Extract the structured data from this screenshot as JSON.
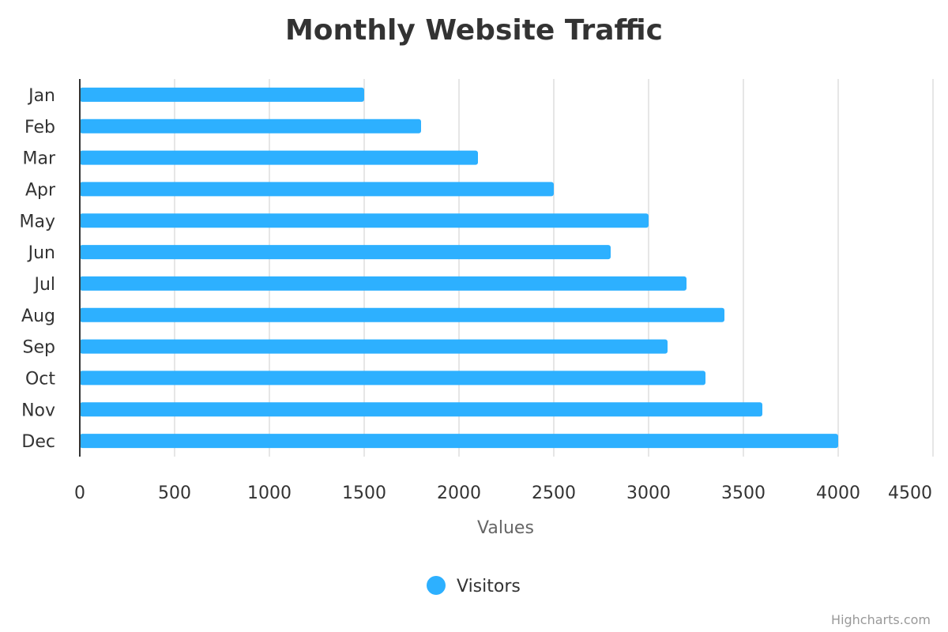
{
  "chart_data": {
    "type": "bar",
    "orientation": "horizontal",
    "title": "Monthly Website Traffic",
    "xlabel": "Values",
    "ylabel": "",
    "categories": [
      "Jan",
      "Feb",
      "Mar",
      "Apr",
      "May",
      "Jun",
      "Jul",
      "Aug",
      "Sep",
      "Oct",
      "Nov",
      "Dec"
    ],
    "series": [
      {
        "name": "Visitors",
        "color": "#2db0ff",
        "values": [
          1500,
          1800,
          2100,
          2500,
          3000,
          2800,
          3200,
          3400,
          3100,
          3300,
          3600,
          4000
        ]
      }
    ],
    "value_axis": {
      "range": [
        0,
        4500
      ],
      "ticks": [
        0,
        500,
        1000,
        1500,
        2000,
        2500,
        3000,
        3500,
        4000,
        4500
      ],
      "tick_labels": [
        "0",
        "500",
        "1000",
        "1500",
        "2000",
        "2500",
        "3000",
        "3500",
        "4000",
        "4500"
      ]
    },
    "grid": true,
    "legend_position": "bottom-center"
  },
  "credits": "Highcharts.com"
}
